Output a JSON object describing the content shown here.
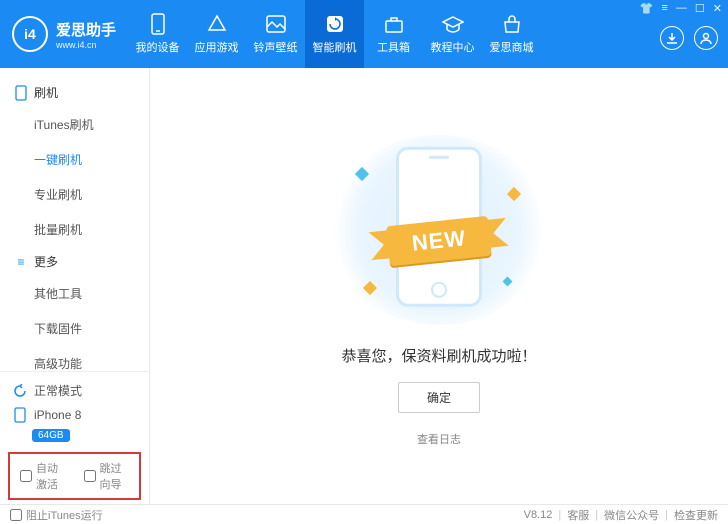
{
  "app": {
    "name": "爱思助手",
    "sub": "www.i4.cn",
    "logo": "i4"
  },
  "nav": [
    {
      "label": "我的设备"
    },
    {
      "label": "应用游戏"
    },
    {
      "label": "铃声壁纸"
    },
    {
      "label": "智能刷机",
      "active": true
    },
    {
      "label": "工具箱"
    },
    {
      "label": "教程中心"
    },
    {
      "label": "爱思商城"
    }
  ],
  "sidebar": {
    "group1": {
      "title": "刷机",
      "items": [
        "iTunes刷机",
        "一键刷机",
        "专业刷机",
        "批量刷机"
      ],
      "activeIndex": 1
    },
    "group2": {
      "title": "更多",
      "items": [
        "其他工具",
        "下载固件",
        "高级功能"
      ]
    }
  },
  "status": {
    "mode": "正常模式",
    "device": "iPhone 8",
    "storage": "64GB"
  },
  "checks": {
    "autoActivate": "自动激活",
    "skipGuide": "跳过向导"
  },
  "main": {
    "ribbon": "NEW",
    "message": "恭喜您，保资料刷机成功啦！",
    "okLabel": "确定",
    "logLink": "查看日志"
  },
  "footer": {
    "blockItunes": "阻止iTunes运行",
    "version": "V8.12",
    "links": [
      "客服",
      "微信公众号",
      "检查更新"
    ]
  }
}
